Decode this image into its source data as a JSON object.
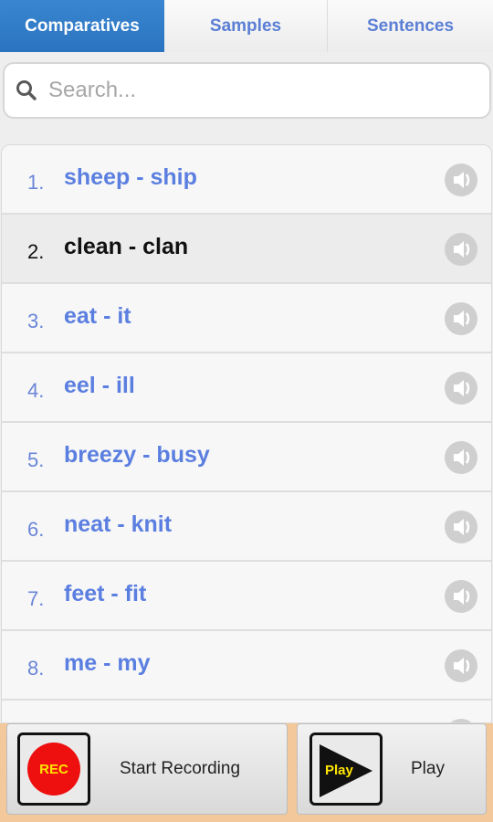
{
  "tabs": [
    {
      "label": "Comparatives",
      "active": true
    },
    {
      "label": "Samples",
      "active": false
    },
    {
      "label": "Sentences",
      "active": false
    }
  ],
  "search": {
    "placeholder": "Search...",
    "value": "",
    "icon": "search-icon"
  },
  "list": {
    "items": [
      {
        "number": "1.",
        "text": "sheep - ship",
        "icon": "speaker-icon"
      },
      {
        "number": "2.",
        "text": "clean - clan",
        "icon": "speaker-icon",
        "selected": true
      },
      {
        "number": "3.",
        "text": "eat - it",
        "icon": "speaker-icon"
      },
      {
        "number": "4.",
        "text": "eel - ill",
        "icon": "speaker-icon"
      },
      {
        "number": "5.",
        "text": "breezy - busy",
        "icon": "speaker-icon"
      },
      {
        "number": "6.",
        "text": "neat - knit",
        "icon": "speaker-icon"
      },
      {
        "number": "7.",
        "text": "feet - fit",
        "icon": "speaker-icon"
      },
      {
        "number": "8.",
        "text": "me - my",
        "icon": "speaker-icon"
      }
    ]
  },
  "bottom_bar": {
    "record": {
      "badge": "REC",
      "label": "Start Recording"
    },
    "play": {
      "badge": "Play",
      "label": "Play"
    }
  },
  "colors": {
    "active_tab": "#2f7cc8",
    "link_text": "#5b7fe0",
    "rec_red": "#ee0f0f",
    "badge_yellow": "#ffe600",
    "bottom_bar": "#f3c89a"
  }
}
